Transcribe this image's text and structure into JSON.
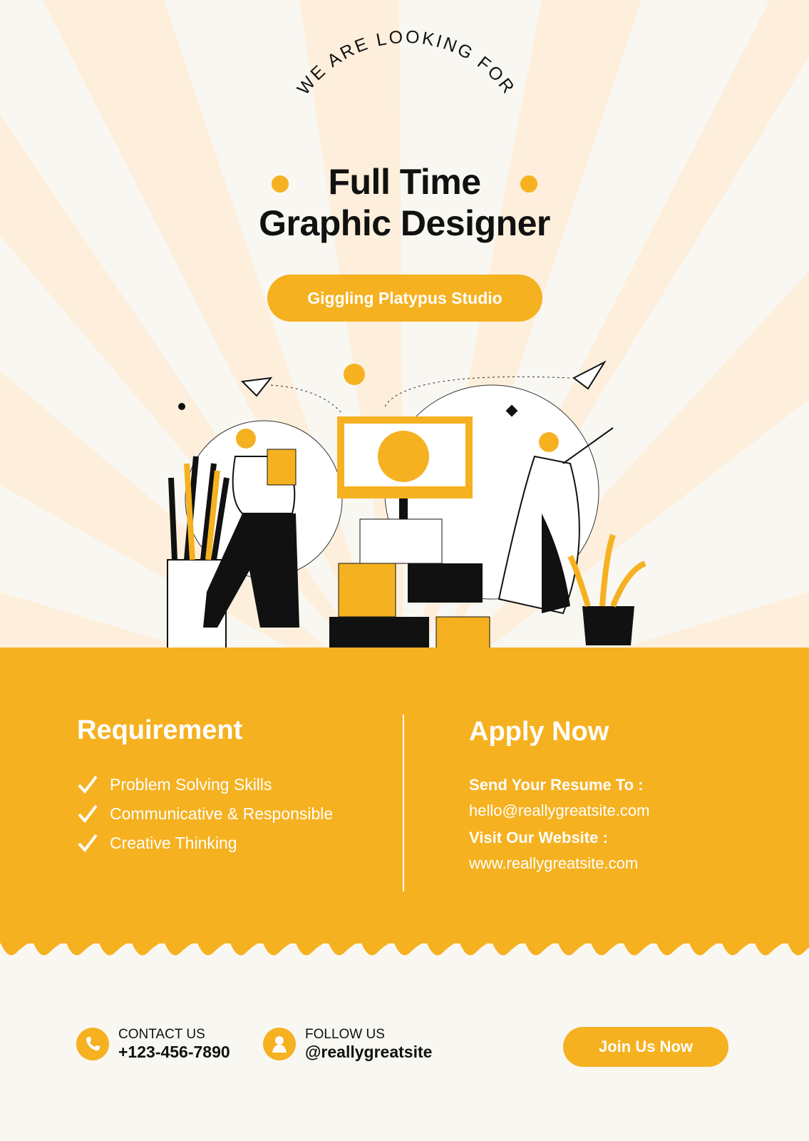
{
  "header": {
    "eyebrow": "WE ARE LOOKING FOR",
    "title_line1": "Full Time",
    "title_line2": "Graphic Designer",
    "company": "Giggling Platypus Studio"
  },
  "requirements": {
    "heading": "Requirement",
    "items": [
      "Problem Solving Skills",
      "Communicative & Responsible",
      "Creative Thinking"
    ]
  },
  "apply": {
    "heading": "Apply Now",
    "resume_label": "Send Your Resume To :",
    "email": "hello@reallygreatsite.com",
    "website_label": "Visit Our Website :",
    "website": "www.reallygreatsite.com"
  },
  "footer": {
    "contact_label": "CONTACT US",
    "phone": "+123-456-7890",
    "follow_label": "FOLLOW US",
    "handle": "@reallygreatsite",
    "join_button": "Join Us Now"
  },
  "colors": {
    "accent": "#F5B120",
    "background": "#F9F7F2",
    "ray": "#FDEFDB"
  }
}
